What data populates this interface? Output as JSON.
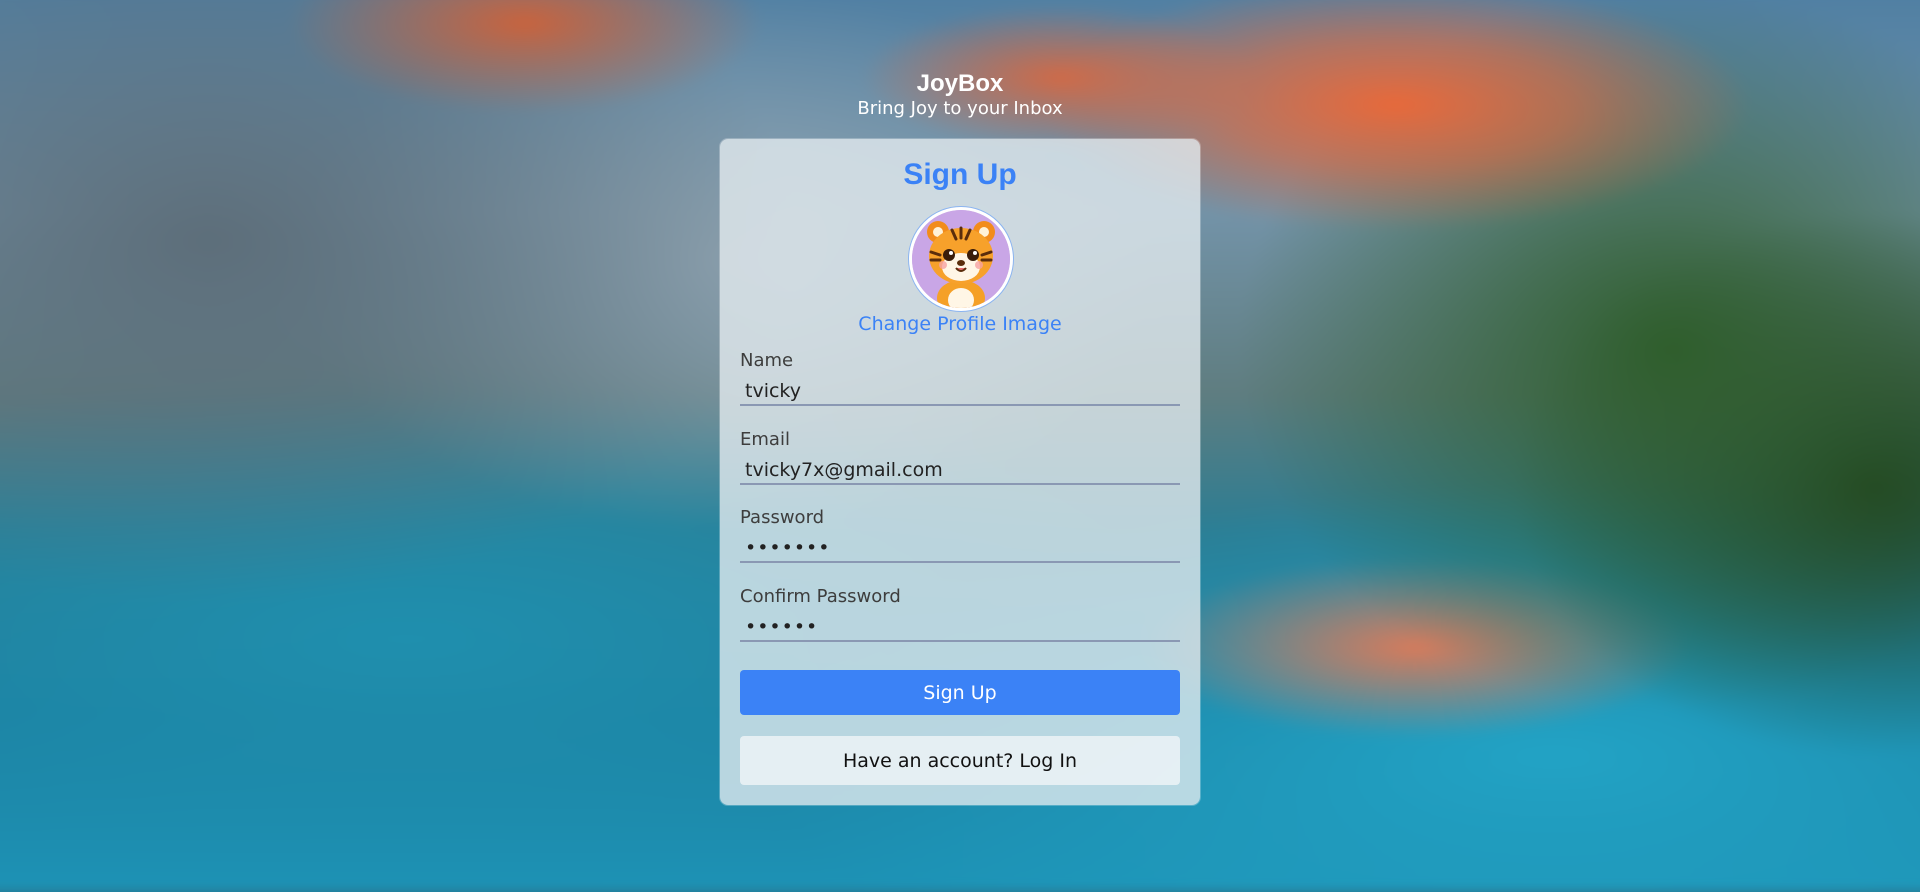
{
  "brand": {
    "name": "JoyBox",
    "tagline": "Bring Joy to your Inbox"
  },
  "form": {
    "title": "Sign Up",
    "avatar_icon": "tiger-cub-avatar",
    "change_image_label": "Change Profile Image",
    "fields": {
      "name": {
        "label": "Name",
        "value": "tvicky"
      },
      "email": {
        "label": "Email",
        "value": "tvicky7x@gmail.com"
      },
      "password": {
        "label": "Password",
        "value": "1234567"
      },
      "confirm_password": {
        "label": "Confirm Password",
        "value": "123456"
      }
    },
    "submit_label": "Sign Up",
    "login_label": "Have an account? Log In"
  },
  "colors": {
    "accent": "#3b82f6",
    "card_bg": "rgba(228,236,240,0.78)",
    "text": "#222222"
  }
}
